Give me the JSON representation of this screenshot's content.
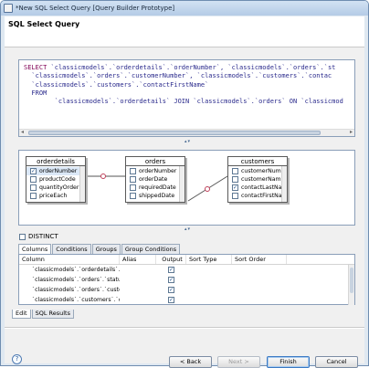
{
  "window": {
    "title": "*New SQL Select Query [Query Builder Prototype]"
  },
  "header": {
    "title": "SQL Select Query"
  },
  "sql_editor": {
    "lines": [
      [
        "SELECT",
        " `classicmodels`.`orderdetails`.`orderNumber`, `classicmodels`.`orders`.`st"
      ],
      [
        "",
        "  `classicmodels`.`orders`.`customerNumber`, `classicmodels`.`customers`.`contac"
      ],
      [
        "",
        "  `classicmodels`.`customers`.`contactFirstName`"
      ],
      [
        "",
        "  FROM"
      ],
      [
        "",
        "        `classicmodels`.`orderdetails` JOIN `classicmodels`.`orders` ON `classicmod"
      ]
    ]
  },
  "diagram": {
    "tables": [
      {
        "name": "orderdetails",
        "columns": [
          {
            "label": "orderNumber",
            "checked": true,
            "selected": true
          },
          {
            "label": "productCode",
            "checked": false,
            "selected": false
          },
          {
            "label": "quantityOrder",
            "checked": false,
            "selected": false
          },
          {
            "label": "priceEach",
            "checked": false,
            "selected": false
          }
        ]
      },
      {
        "name": "orders",
        "columns": [
          {
            "label": "orderNumber",
            "checked": false,
            "selected": false
          },
          {
            "label": "orderDate",
            "checked": false,
            "selected": false
          },
          {
            "label": "requiredDate",
            "checked": false,
            "selected": false
          },
          {
            "label": "shippedDate",
            "checked": false,
            "selected": false
          }
        ]
      },
      {
        "name": "customers",
        "columns": [
          {
            "label": "customerNum",
            "checked": false,
            "selected": false
          },
          {
            "label": "customerNam",
            "checked": false,
            "selected": false
          },
          {
            "label": "contactLastNam",
            "checked": true,
            "selected": false
          },
          {
            "label": "contactFirstNam",
            "checked": false,
            "selected": false
          }
        ]
      }
    ]
  },
  "distinct": {
    "label": "DISTINCT",
    "checked": false
  },
  "tabs": [
    {
      "label": "Columns",
      "active": true
    },
    {
      "label": "Conditions",
      "active": false
    },
    {
      "label": "Groups",
      "active": false
    },
    {
      "label": "Group Conditions",
      "active": false
    }
  ],
  "grid": {
    "headers": [
      "Column",
      "Alias",
      "Output",
      "Sort Type",
      "Sort Order"
    ],
    "rows": [
      {
        "column": "`classicmodels`.`orderdetails`.`o...",
        "alias": "",
        "output": true,
        "sort_type": "",
        "sort_order": ""
      },
      {
        "column": "`classicmodels`.`orders`.`status`",
        "alias": "",
        "output": true,
        "sort_type": "",
        "sort_order": ""
      },
      {
        "column": "`classicmodels`.`orders`.`custo...",
        "alias": "",
        "output": true,
        "sort_type": "",
        "sort_order": ""
      },
      {
        "column": "`classicmodels`.`customers`.`co...",
        "alias": "",
        "output": true,
        "sort_type": "",
        "sort_order": ""
      }
    ]
  },
  "bottom_tabs": [
    {
      "label": "Edit",
      "active": true
    },
    {
      "label": "SQL Results",
      "active": false
    }
  ],
  "buttons": {
    "help": "?",
    "back": "< Back",
    "next": "Next >",
    "finish": "Finish",
    "cancel": "Cancel"
  }
}
